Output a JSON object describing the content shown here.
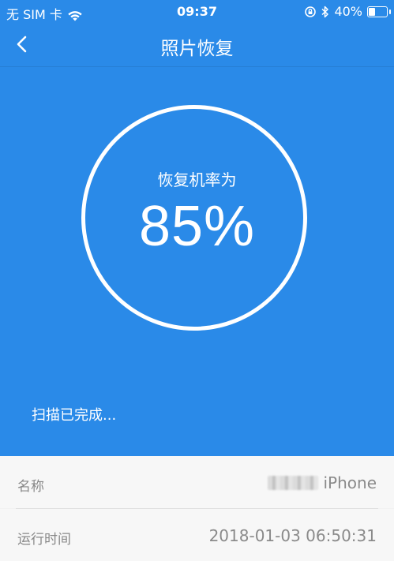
{
  "status_bar": {
    "carrier": "无 SIM 卡",
    "time": "09:37",
    "battery": "40%",
    "battery_level": 0.4,
    "icons": [
      "wifi-icon",
      "rotation-lock-icon",
      "bluetooth-icon",
      "battery-icon"
    ]
  },
  "nav": {
    "title": "照片恢复",
    "back_icon": "chevron-left-icon"
  },
  "progress": {
    "label": "恢复机率为",
    "value": "85%",
    "value_fraction": 0.85
  },
  "scan": {
    "status": "扫描已完成..."
  },
  "device_info": {
    "name_label": "名称",
    "name_value": "iPhone",
    "runtime_label": "运行时间",
    "runtime_value": "2018-01-03 06:50:31"
  },
  "colors": {
    "primary": "#2a8ae8",
    "panel": "#f7f7f7",
    "text_muted": "#888888",
    "white": "#ffffff"
  }
}
